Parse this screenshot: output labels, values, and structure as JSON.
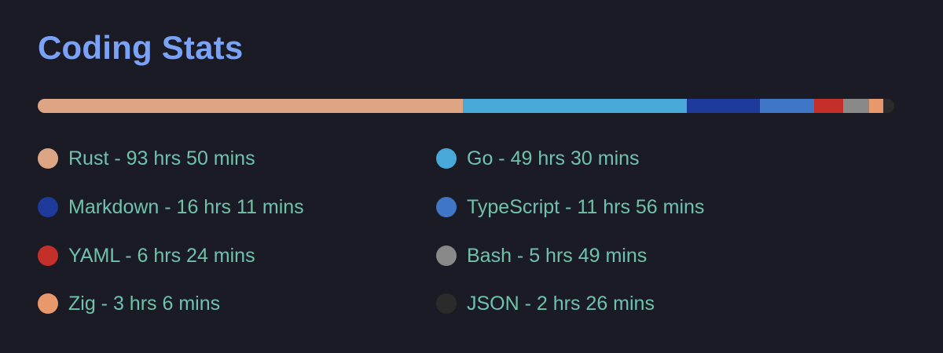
{
  "header": {
    "title": "Coding Stats"
  },
  "chart_data": {
    "type": "bar",
    "title": "Coding Stats",
    "unit": "minutes",
    "categories": [
      "Rust",
      "Go",
      "Markdown",
      "TypeScript",
      "YAML",
      "Bash",
      "Zig",
      "JSON"
    ],
    "values": [
      5630,
      2970,
      971,
      716,
      384,
      349,
      186,
      146
    ],
    "colors": [
      "#dea584",
      "#48a9d8",
      "#1e3a9a",
      "#3f76c6",
      "#c42f2a",
      "#898989",
      "#e8986a",
      "#2b2b2b"
    ],
    "legend_placement": "below",
    "legend_columns": 2,
    "legend_labels": [
      "Rust - 93 hrs 50 mins",
      "Go - 49 hrs 30 mins",
      "Markdown - 16 hrs 11 mins",
      "TypeScript - 11 hrs 56 mins",
      "YAML - 6 hrs 24 mins",
      "Bash - 5 hrs 49 mins",
      "Zig - 3 hrs 6 mins",
      "JSON - 2 hrs 26 mins"
    ]
  }
}
